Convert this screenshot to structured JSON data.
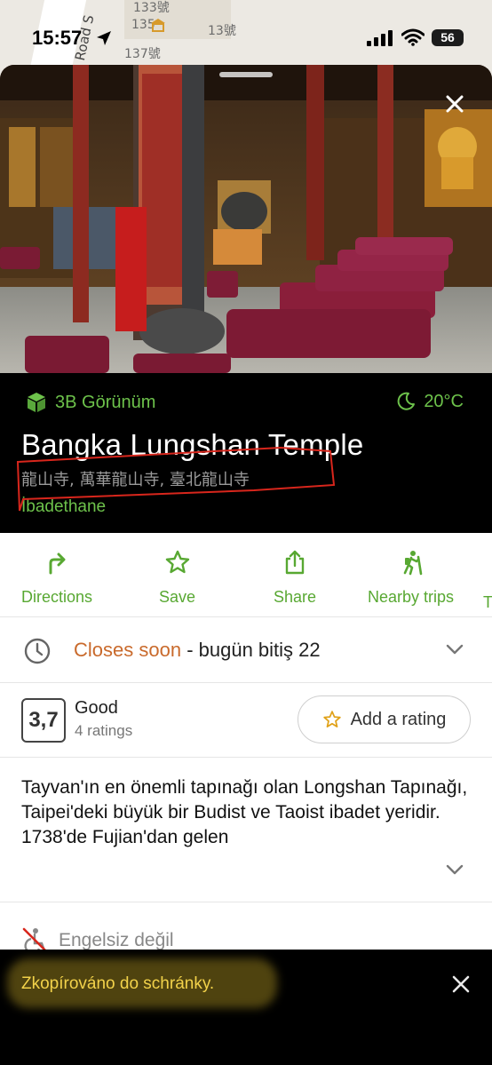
{
  "map": {
    "road_name": "n Road S",
    "labels": [
      "133號",
      "135",
      "13號",
      "137號"
    ]
  },
  "status_bar": {
    "time": "15:57",
    "battery": "56"
  },
  "place": {
    "view_3d_label": "3B Görünüm",
    "temperature": "20°C",
    "title": "Bangka Lungshan Temple",
    "alt_names": "龍山寺, 萬華龍山寺, 臺北龍山寺",
    "category": "İbadethane"
  },
  "actions": [
    {
      "label": "Directions",
      "icon": "directions-icon"
    },
    {
      "label": "Save",
      "icon": "star-icon"
    },
    {
      "label": "Share",
      "icon": "share-icon"
    },
    {
      "label": "Nearby trips",
      "icon": "hiker-icon"
    },
    {
      "label": "T",
      "icon": ""
    }
  ],
  "hours": {
    "status": "Closes soon",
    "detail": " - bugün bitiş 22"
  },
  "rating": {
    "score": "3,7",
    "word": "Good",
    "count": "4 ratings",
    "add_label": "Add a rating"
  },
  "description": "Tayvan'ın en önemli tapınağı olan Longshan Tapınağı, Taipei'deki büyük bir Budist ve Taoist ibadet yeridir. 1738'de Fujian'dan gelen",
  "accessibility": {
    "label": "Engelsiz değil"
  },
  "toast": {
    "message": "Zkopírováno do schránky."
  },
  "colors": {
    "accent": "#58a832",
    "warning": "#c96a2c",
    "toast_text": "#f2d24a"
  }
}
